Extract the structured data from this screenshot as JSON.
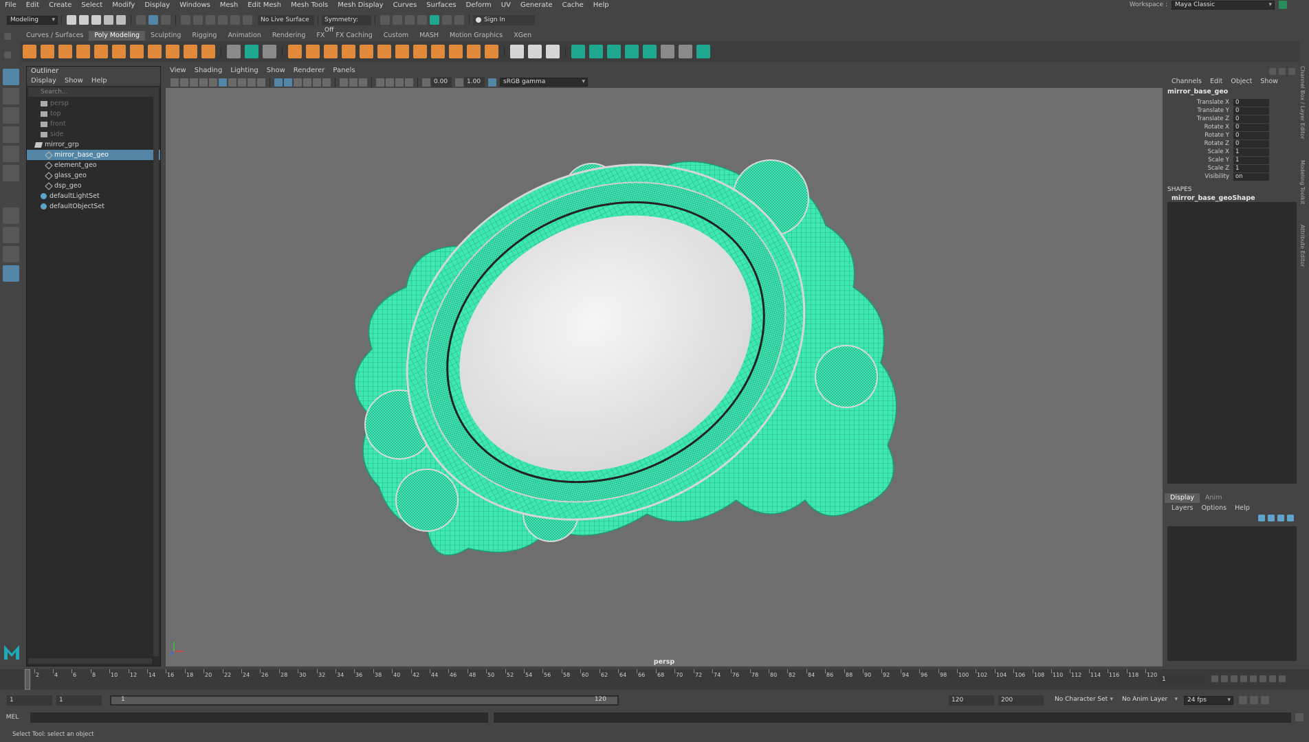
{
  "menubar": {
    "items": [
      "File",
      "Edit",
      "Create",
      "Select",
      "Modify",
      "Display",
      "Windows",
      "Mesh",
      "Edit Mesh",
      "Mesh Tools",
      "Mesh Display",
      "Curves",
      "Surfaces",
      "Deform",
      "UV",
      "Generate",
      "Cache",
      "Help"
    ],
    "workspace_label": "Workspace :",
    "workspace_value": "Maya Classic"
  },
  "statusline": {
    "mode": "Modeling",
    "live_surface": "No Live Surface",
    "symmetry": "Symmetry: Off",
    "sign_in": "Sign In"
  },
  "shelf": {
    "tabs": [
      "Curves / Surfaces",
      "Poly Modeling",
      "Sculpting",
      "Rigging",
      "Animation",
      "Rendering",
      "FX",
      "FX Caching",
      "Custom",
      "MASH",
      "Motion Graphics",
      "XGen"
    ],
    "active_tab": "Poly Modeling"
  },
  "outliner": {
    "title": "Outliner",
    "menu": [
      "Display",
      "Show",
      "Help"
    ],
    "search_placeholder": "Search...",
    "items": [
      {
        "label": "persp",
        "type": "camera",
        "dim": true
      },
      {
        "label": "top",
        "type": "camera",
        "dim": true
      },
      {
        "label": "front",
        "type": "camera",
        "dim": true
      },
      {
        "label": "side",
        "type": "camera",
        "dim": true
      },
      {
        "label": "mirror_grp",
        "type": "group",
        "dim": false
      },
      {
        "label": "mirror_base_geo",
        "type": "mesh",
        "dim": false,
        "selected": true
      },
      {
        "label": "element_geo",
        "type": "mesh",
        "dim": false
      },
      {
        "label": "glass_geo",
        "type": "mesh",
        "dim": false
      },
      {
        "label": "dsp_geo",
        "type": "mesh",
        "dim": false
      },
      {
        "label": "defaultLightSet",
        "type": "set",
        "dim": false
      },
      {
        "label": "defaultObjectSet",
        "type": "set",
        "dim": false
      }
    ]
  },
  "viewport": {
    "menu": [
      "View",
      "Shading",
      "Lighting",
      "Show",
      "Renderer",
      "Panels"
    ],
    "exposure": "0.00",
    "gamma": "1.00",
    "color_space": "sRGB gamma",
    "camera_label": "persp",
    "wire_color": "#3df0b3",
    "background_color": "#6e6e6e"
  },
  "channelbox": {
    "menu": [
      "Channels",
      "Edit",
      "Object",
      "Show"
    ],
    "object": "mirror_base_geo",
    "attributes": [
      {
        "name": "Translate X",
        "value": "0"
      },
      {
        "name": "Translate Y",
        "value": "0"
      },
      {
        "name": "Translate Z",
        "value": "0"
      },
      {
        "name": "Rotate X",
        "value": "0"
      },
      {
        "name": "Rotate Y",
        "value": "0"
      },
      {
        "name": "Rotate Z",
        "value": "0"
      },
      {
        "name": "Scale X",
        "value": "1"
      },
      {
        "name": "Scale Y",
        "value": "1"
      },
      {
        "name": "Scale Z",
        "value": "1"
      },
      {
        "name": "Visibility",
        "value": "on"
      }
    ],
    "shapes_header": "SHAPES",
    "shape_name": "mirror_base_geoShape"
  },
  "layers": {
    "tabs": [
      "Display",
      "Anim"
    ],
    "menu": [
      "Layers",
      "Options",
      "Help"
    ]
  },
  "right_tabs": [
    "Channel Box / Layer Editor",
    "Modeling Toolkit",
    "Attribute Editor"
  ],
  "timeline": {
    "ticks": [
      "1",
      "2",
      "4",
      "6",
      "8",
      "10",
      "12",
      "14",
      "16",
      "18",
      "20",
      "22",
      "24",
      "26",
      "28",
      "30",
      "32",
      "34",
      "36",
      "38",
      "40",
      "42",
      "44",
      "46",
      "48",
      "50",
      "52",
      "54",
      "56",
      "58",
      "60",
      "62",
      "64",
      "66",
      "68",
      "70",
      "72",
      "74",
      "76",
      "78",
      "80",
      "82",
      "84",
      "86",
      "88",
      "90",
      "92",
      "94",
      "96",
      "98",
      "100",
      "102",
      "104",
      "106",
      "108",
      "110",
      "112",
      "114",
      "116",
      "118",
      "120"
    ],
    "current_frame": "1"
  },
  "range": {
    "start": "1",
    "playback_start": "1",
    "slider_start": "1",
    "slider_end": "120",
    "playback_end": "120",
    "end": "200",
    "char_set": "No Character Set",
    "anim_layer": "No Anim Layer",
    "fps": "24 fps"
  },
  "cmdline": {
    "label": "MEL"
  },
  "helpline": {
    "text": "Select Tool: select an object"
  }
}
